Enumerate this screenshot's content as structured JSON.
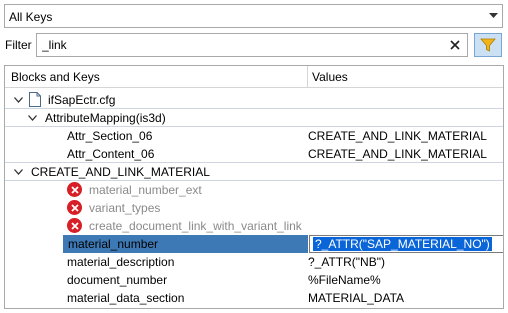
{
  "scope": {
    "selected": "All Keys"
  },
  "filter": {
    "label": "Filter",
    "value": "_link"
  },
  "tree": {
    "columns": {
      "keys": "Blocks and Keys",
      "values": "Values"
    },
    "file": "ifSapEctr.cfg",
    "block1": {
      "name": "AttributeMapping(is3d)",
      "rows": [
        {
          "key": "Attr_Section_06",
          "value": "CREATE_AND_LINK_MATERIAL"
        },
        {
          "key": "Attr_Content_06",
          "value": "CREATE_AND_LINK_MATERIAL"
        }
      ]
    },
    "block2": {
      "name": "CREATE_AND_LINK_MATERIAL",
      "errors": [
        "material_number_ext",
        "variant_types",
        "create_document_link_with_variant_link"
      ],
      "selected": {
        "key": "material_number",
        "value": "?_ATTR(\"SAP_MATERIAL_NO\")"
      },
      "rows": [
        {
          "key": "material_description",
          "value": "?_ATTR(\"NB\")"
        },
        {
          "key": "document_number",
          "value": "%FileName%"
        },
        {
          "key": "material_data_section",
          "value": "MATERIAL_DATA"
        }
      ]
    }
  }
}
